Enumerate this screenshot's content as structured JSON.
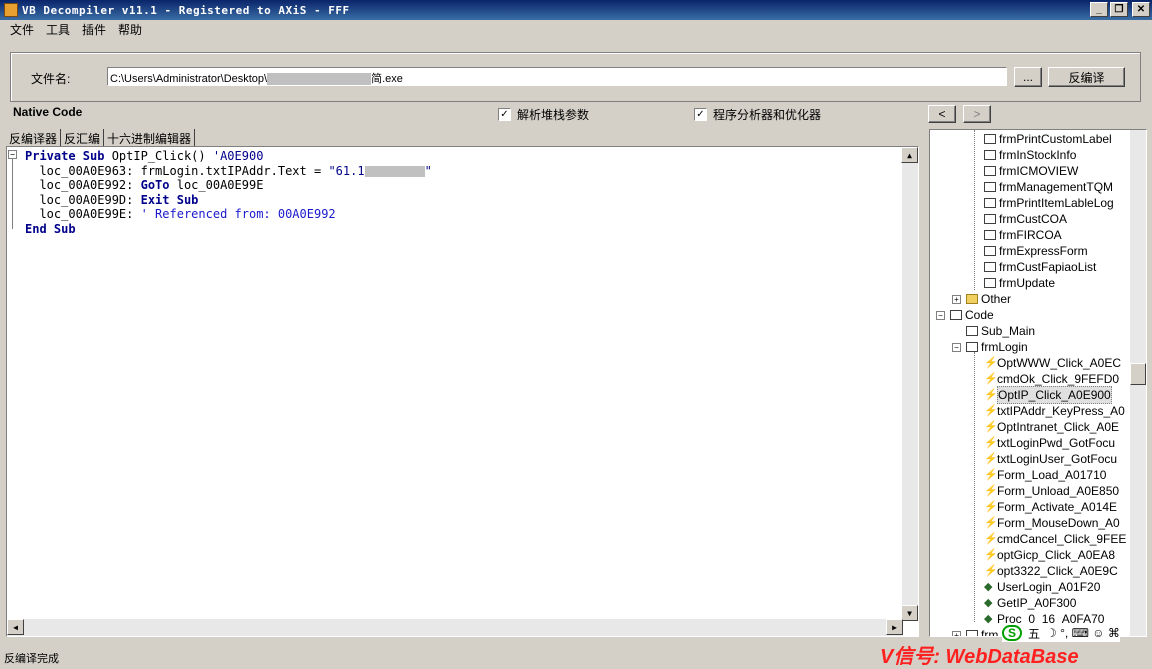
{
  "window": {
    "title": "VB Decompiler v11.1 - Registered to AXiS - FFF"
  },
  "menu": [
    "文件",
    "工具",
    "插件",
    "帮助"
  ],
  "file": {
    "label": "文件名:",
    "path_prefix": "C:\\Users\\Administrator\\Desktop\\",
    "path_suffix": "简.exe",
    "browse_label": "...",
    "decompile_label": "反编译"
  },
  "options": {
    "native_code": "Native Code",
    "parse_stack": "解析堆栈参数",
    "analyzer": "程序分析器和优化器",
    "prev": "<",
    "next": ">"
  },
  "tabs": [
    "反编译器",
    "反汇编",
    "十六进制编辑器"
  ],
  "code": {
    "l1_kw": "Private Sub",
    "l1_name": " OptIP_Click() ",
    "l1_comment": "'A0E900",
    "l2_pre": "  loc_00A0E963: frmLogin.txtIPAddr.Text = ",
    "l2_str": "\"61.1",
    "l2_end": "\"",
    "l3_pre": "  loc_00A0E992: ",
    "l3_kw": "GoTo",
    "l3_post": " loc_00A0E99E",
    "l4_pre": "  loc_00A0E99D: ",
    "l4_kw": "Exit Sub",
    "l5_pre": "  loc_00A0E99E: ",
    "l5_cm": "' Referenced from: 00A0E992",
    "l6_kw": "End Sub"
  },
  "tree": {
    "forms_top": [
      "frmPrintCustomLabel",
      "frmInStockInfo",
      "frmICMOVIEW",
      "frmManagementTQM",
      "frmPrintItemLableLog",
      "frmCustCOA",
      "frmFIRCOA",
      "frmExpressForm",
      "frmCustFapiaoList",
      "frmUpdate"
    ],
    "other": "Other",
    "code": "Code",
    "sub_main": "Sub_Main",
    "frmlogin": "frmLogin",
    "procs": [
      "OptWWW_Click_A0EC",
      "cmdOk_Click_9FEFD0",
      "OptIP_Click_A0E900",
      "txtIPAddr_KeyPress_A0",
      "OptIntranet_Click_A0E",
      "txtLoginPwd_GotFocu",
      "txtLoginUser_GotFocu",
      "Form_Load_A01710",
      "Form_Unload_A0E850",
      "Form_Activate_A014E",
      "Form_MouseDown_A0",
      "cmdCancel_Click_9FEE",
      "optGicp_Click_A0EA8",
      "opt3322_Click_A0E9C"
    ],
    "globals": [
      "UserLogin_A01F20",
      "GetIP_A0F300",
      "Proc_0_16_A0FA70"
    ],
    "last": "frm"
  },
  "status": "反编译完成",
  "ime": {
    "logo": "S",
    "mode": "五",
    "icons": "☽ °, ⌨ ☺ ⌘"
  },
  "watermark": "V信号: WebDataBase"
}
